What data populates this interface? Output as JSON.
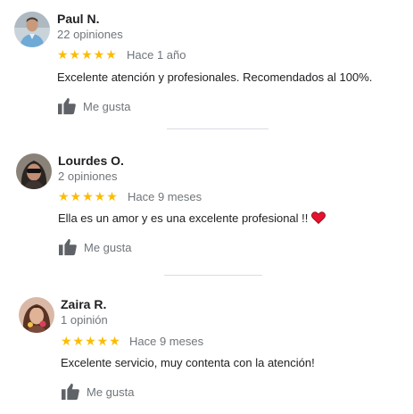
{
  "reviews": [
    {
      "name": "Paul N.",
      "count": "22 opiniones",
      "stars": "★★★★★",
      "time": "Hace 1 año",
      "text": "Excelente atención y profesionales. Recomendados al 100%.",
      "like_label": "Me gusta",
      "avatar_icon": "person-photo-avatar"
    },
    {
      "name": "Lourdes O.",
      "count": "2 opiniones",
      "stars": "★★★★★",
      "time": "Hace 9 meses",
      "text": "Ella es un amor y es una excelente profesional !!",
      "text_icon": "red-heart-emoji",
      "like_label": "Me gusta",
      "avatar_icon": "person-photo-avatar"
    },
    {
      "name": "Zaira R.",
      "count": "1 opinión",
      "stars": "★★★★★",
      "time": "Hace 9 meses",
      "text": "Excelente servicio, muy contenta con la atención!",
      "like_label": "Me gusta",
      "avatar_icon": "person-photo-avatar"
    }
  ],
  "rating": 5,
  "colors": {
    "star": "#fbbc04",
    "secondary_text": "#70757a",
    "primary_text": "#202124",
    "divider": "#dadce0",
    "thumb_icon": "#5f6368",
    "heart": "#e8112d"
  }
}
